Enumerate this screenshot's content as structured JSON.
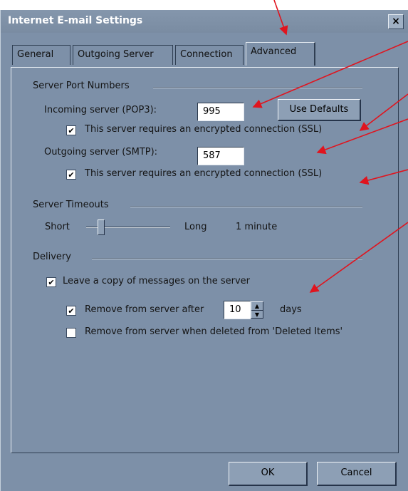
{
  "dialog": {
    "title": "Internet E-mail Settings",
    "close_label": "×"
  },
  "tabs": [
    {
      "label": "General",
      "selected": false
    },
    {
      "label": "Outgoing Server",
      "selected": false
    },
    {
      "label": "Connection",
      "selected": false
    },
    {
      "label": "Advanced",
      "selected": true
    }
  ],
  "server_ports": {
    "group_label": "Server Port Numbers",
    "incoming_label": "Incoming server (POP3):",
    "incoming_value": "995",
    "use_defaults_label": "Use Defaults",
    "incoming_ssl_label": "This server requires an encrypted connection (SSL)",
    "incoming_ssl_checked": true,
    "outgoing_label": "Outgoing server (SMTP):",
    "outgoing_value": "587",
    "outgoing_ssl_label": "This server requires an encrypted connection (SSL)",
    "outgoing_ssl_checked": true
  },
  "timeouts": {
    "group_label": "Server Timeouts",
    "short_label": "Short",
    "long_label": "Long",
    "value_label": "1 minute",
    "slider_level": 0.15
  },
  "delivery": {
    "group_label": "Delivery",
    "leave_copy_label": "Leave a copy of messages on the server",
    "leave_copy_checked": true,
    "remove_after_label": "Remove from server after",
    "remove_after_checked": true,
    "days_value": "10",
    "days_label": "days",
    "remove_deleted_label": "Remove from server when deleted from 'Deleted Items'",
    "remove_deleted_checked": false
  },
  "footer": {
    "ok_label": "OK",
    "cancel_label": "Cancel"
  },
  "colors": {
    "dialog_bg": "#7d90a8",
    "annotation_arrow": "#e0141e"
  },
  "icons": {
    "check": "✔",
    "spin_up": "▲",
    "spin_down": "▼"
  }
}
